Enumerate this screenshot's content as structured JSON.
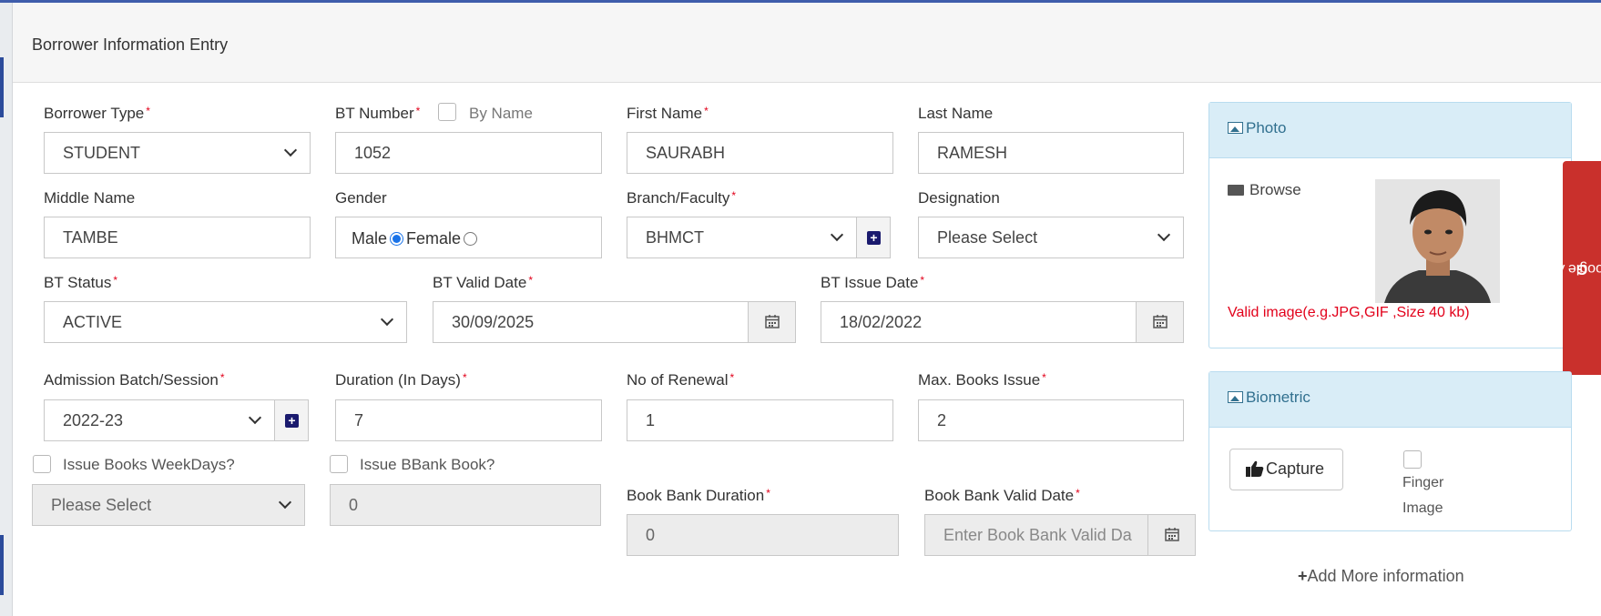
{
  "panel_title": "Borrower Information Entry",
  "fields": {
    "borrower_type": {
      "label": "Borrower Type",
      "value": "STUDENT"
    },
    "bt_number": {
      "label": "BT Number",
      "value": "1052",
      "by_name_label": "By Name"
    },
    "first_name": {
      "label": "First Name",
      "value": "SAURABH"
    },
    "last_name": {
      "label": "Last Name",
      "value": "RAMESH"
    },
    "middle_name": {
      "label": "Middle Name",
      "value": "TAMBE"
    },
    "gender": {
      "label": "Gender",
      "male_label": "Male",
      "female_label": "Female",
      "selected": "Male"
    },
    "branch_faculty": {
      "label": "Branch/Faculty",
      "value": "BHMCT"
    },
    "designation": {
      "label": "Designation",
      "value": "Please Select"
    },
    "bt_status": {
      "label": "BT Status",
      "value": "ACTIVE"
    },
    "bt_valid_date": {
      "label": "BT Valid Date",
      "value": "30/09/2025"
    },
    "bt_issue_date": {
      "label": "BT Issue Date",
      "value": "18/02/2022"
    },
    "admission_batch": {
      "label": "Admission Batch/Session",
      "value": "2022-23"
    },
    "duration_days": {
      "label": "Duration (In Days)",
      "value": "7"
    },
    "no_of_renewal": {
      "label": "No of Renewal",
      "value": "1"
    },
    "max_books_issue": {
      "label": "Max. Books Issue",
      "value": "2"
    },
    "issue_books_weekdays": {
      "label": "Issue Books WeekDays?",
      "value": "Please Select"
    },
    "issue_bbank_book": {
      "label": "Issue BBank Book?",
      "value": "0"
    },
    "book_bank_duration": {
      "label": "Book Bank Duration",
      "value": "0"
    },
    "book_bank_valid_date": {
      "label": "Book Bank Valid Date",
      "placeholder": "Enter Book Bank Valid Da"
    }
  },
  "photo_card": {
    "title": "Photo",
    "browse_label": "Browse",
    "hint": "Valid image(e.g.JPG,GIF ,Size 40 kb)"
  },
  "biometric_card": {
    "title": "Biometric",
    "capture_label": "Capture",
    "finger_label_1": "Finger",
    "finger_label_2": "Image"
  },
  "sync_button_label": "Sync Google Account",
  "add_more_label": "Add More information",
  "colors": {
    "accent": "#3f5dab",
    "required": "#e2001a",
    "card_header": "#d9edf7",
    "sync": "#c9302c",
    "hint": "#e2001a"
  }
}
